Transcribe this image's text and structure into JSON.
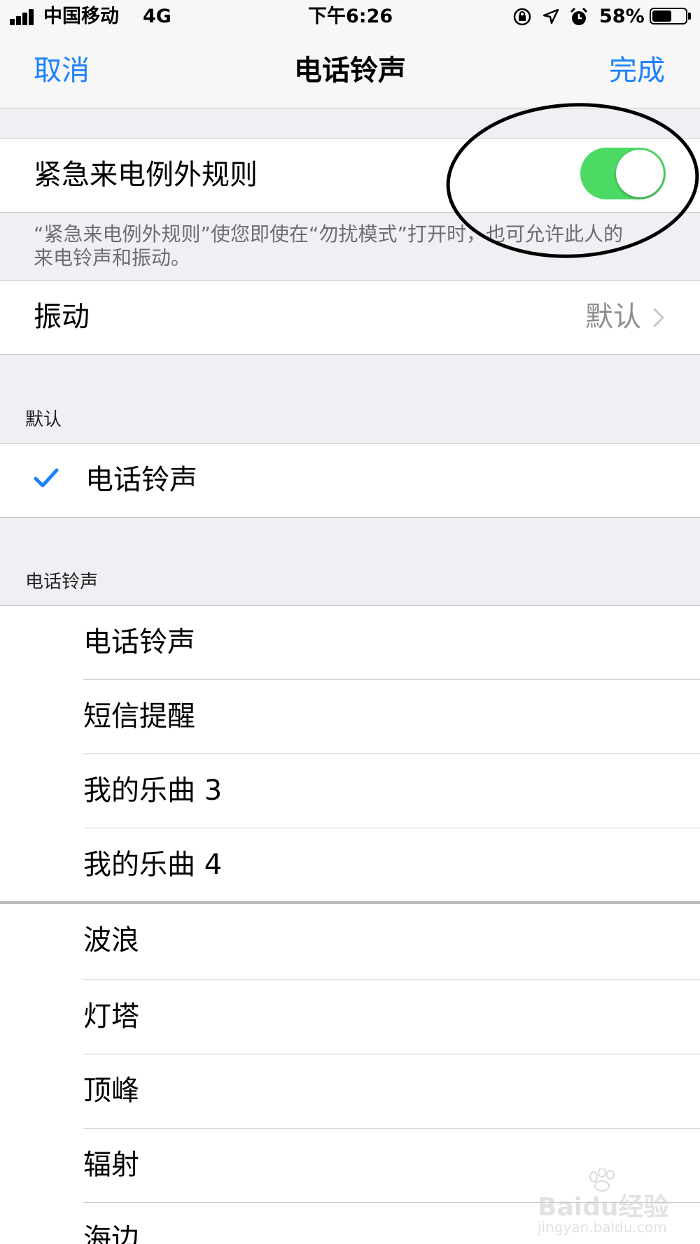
{
  "status_bar": {
    "carrier": "中国移动",
    "network": "4G",
    "time": "下午6:26",
    "battery_percent": "58%",
    "battery_level": 0.58
  },
  "nav": {
    "cancel": "取消",
    "title": "电话铃声",
    "done": "完成"
  },
  "emergency": {
    "label": "紧急来电例外规则",
    "enabled": true,
    "footnote_line1": "“紧急来电例外规则”使您即使在“勿扰模式”打开时，也可允许此人的",
    "footnote_line2": "来电铃声和振动。"
  },
  "vibration": {
    "label": "振动",
    "value": "默认"
  },
  "default_section": {
    "header": "默认",
    "item": "电话铃声"
  },
  "ringtone_section": {
    "header": "电话铃声",
    "items": [
      "电话铃声",
      "短信提醒",
      "我的乐曲 3",
      "我的乐曲 4",
      "波浪",
      "灯塔",
      "顶峰",
      "辐射",
      "海边"
    ]
  },
  "watermark": {
    "brand": "Baidu经验",
    "url": "jingyan.baidu.com"
  }
}
